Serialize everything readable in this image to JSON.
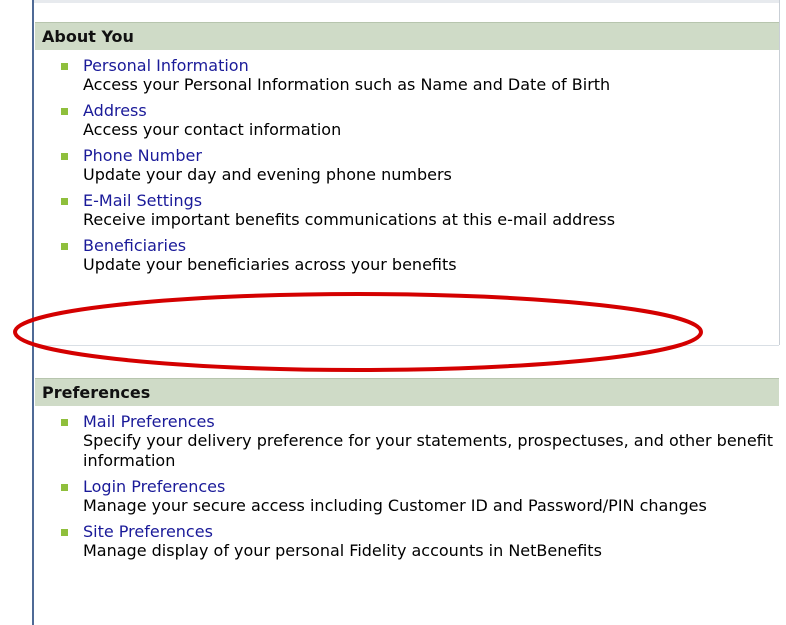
{
  "about": {
    "title": "About You",
    "items": [
      {
        "link": "Personal Information",
        "desc": "Access your Personal Information such as Name and Date of Birth"
      },
      {
        "link": "Address",
        "desc": "Access your contact information"
      },
      {
        "link": "Phone Number",
        "desc": "Update your day and evening phone numbers"
      },
      {
        "link": "E-Mail Settings",
        "desc": "Receive important benefits communications at this e-mail address"
      },
      {
        "link": "Beneficiaries",
        "desc": "Update your beneficiaries across your benefits"
      }
    ]
  },
  "preferences": {
    "title": "Preferences",
    "items": [
      {
        "link": "Mail Preferences",
        "desc": "Specify your delivery preference for your statements, prospectuses, and other benefit information"
      },
      {
        "link": "Login Preferences",
        "desc": "Manage your secure access including Customer ID and Password/PIN changes"
      },
      {
        "link": "Site Preferences",
        "desc": "Manage display of your personal Fidelity accounts in NetBenefits"
      }
    ]
  },
  "colors": {
    "header_bg": "#cfdbc7",
    "link": "#1a1a99",
    "bullet": "#8fbf3c",
    "annotation": "#d40000"
  },
  "icons": {
    "bullet": "square-bullet-icon"
  }
}
